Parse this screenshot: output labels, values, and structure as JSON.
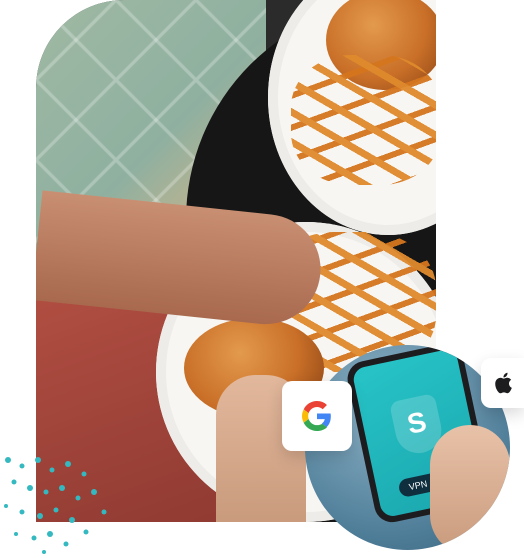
{
  "hero": {
    "description_name": "food-photo"
  },
  "app": {
    "vpn_label": "VPN",
    "check_glyph": "✓",
    "logo_letter": "S"
  },
  "badges": {
    "google_icon": "google-icon",
    "apple_icon": "apple-icon"
  },
  "colors": {
    "dots": "#35b9c0",
    "google_blue": "#4285F4",
    "google_red": "#EA4335",
    "google_yellow": "#FBBC05",
    "google_green": "#34A853",
    "apple": "#1d1d1f"
  }
}
